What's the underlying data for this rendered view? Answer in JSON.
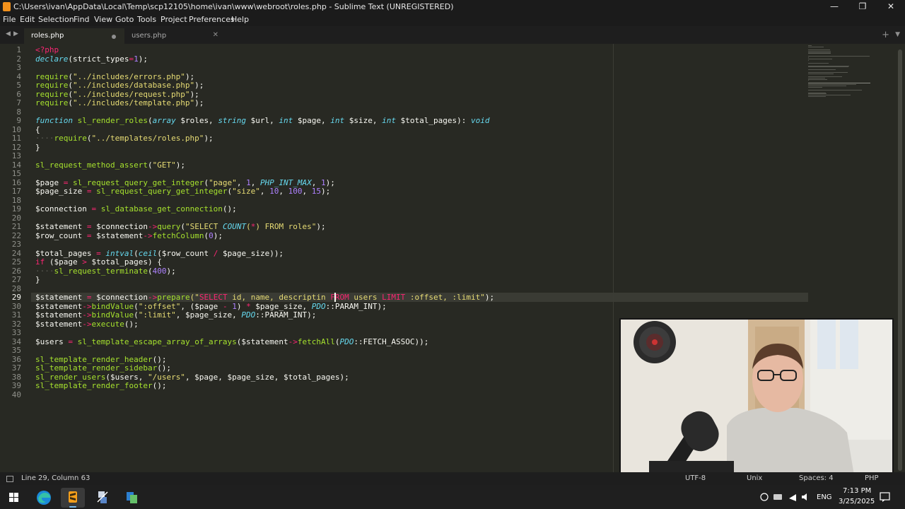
{
  "window": {
    "title": "C:\\Users\\ivan\\AppData\\Local\\Temp\\scp12105\\home\\ivan\\www\\webroot\\roles.php - Sublime Text (UNREGISTERED)",
    "minimize": "—",
    "maximize": "❐",
    "close": "✕"
  },
  "menu": {
    "file": "File",
    "edit": "Edit",
    "selection": "Selection",
    "find": "Find",
    "view": "View",
    "goto": "Goto",
    "tools": "Tools",
    "project": "Project",
    "preferences": "Preferences",
    "help": "Help"
  },
  "tabs": [
    {
      "label": "roles.php",
      "active": true,
      "dirty": true
    },
    {
      "label": "users.php",
      "active": false,
      "dirty": false
    }
  ],
  "tabbar": {
    "back": "◀",
    "forward": "▶",
    "new_tab": "+",
    "tab_menu": "▼",
    "close": "✕"
  },
  "editor": {
    "current_line": 29,
    "line_numbers": [
      "1",
      "2",
      "3",
      "4",
      "5",
      "6",
      "7",
      "8",
      "9",
      "10",
      "11",
      "12",
      "13",
      "14",
      "15",
      "16",
      "17",
      "18",
      "19",
      "20",
      "21",
      "22",
      "23",
      "24",
      "25",
      "26",
      "27",
      "28",
      "29",
      "30",
      "31",
      "32",
      "33",
      "34",
      "35",
      "36",
      "37",
      "38",
      "39",
      "40"
    ],
    "lines": [
      [
        [
          "<?php",
          "c-tag"
        ]
      ],
      [
        [
          "declare",
          "c-it"
        ],
        [
          "(",
          "c-var"
        ],
        [
          "strict_types",
          "c-var"
        ],
        [
          "=",
          "c-op"
        ],
        [
          "1",
          "c-num"
        ],
        [
          ");",
          "c-var"
        ]
      ],
      [],
      [
        [
          "require",
          "c-fn"
        ],
        [
          "(",
          "c-var"
        ],
        [
          "\"../includes/errors.php\"",
          "c-str"
        ],
        [
          ");",
          "c-var"
        ]
      ],
      [
        [
          "require",
          "c-fn"
        ],
        [
          "(",
          "c-var"
        ],
        [
          "\"../includes/database.php\"",
          "c-str"
        ],
        [
          ");",
          "c-var"
        ]
      ],
      [
        [
          "require",
          "c-fn"
        ],
        [
          "(",
          "c-var"
        ],
        [
          "\"../includes/request.php\"",
          "c-str"
        ],
        [
          ");",
          "c-var"
        ]
      ],
      [
        [
          "require",
          "c-fn"
        ],
        [
          "(",
          "c-var"
        ],
        [
          "\"../includes/template.php\"",
          "c-str"
        ],
        [
          ");",
          "c-var"
        ]
      ],
      [],
      [
        [
          "function",
          "c-type"
        ],
        [
          " ",
          "c-var"
        ],
        [
          "sl_render_roles",
          "c-fn"
        ],
        [
          "(",
          "c-var"
        ],
        [
          "array",
          "c-type"
        ],
        [
          " $roles, ",
          "c-var"
        ],
        [
          "string",
          "c-type"
        ],
        [
          " $url, ",
          "c-var"
        ],
        [
          "int",
          "c-type"
        ],
        [
          " $page, ",
          "c-var"
        ],
        [
          "int",
          "c-type"
        ],
        [
          " $size, ",
          "c-var"
        ],
        [
          "int",
          "c-type"
        ],
        [
          " $total_pages): ",
          "c-var"
        ],
        [
          "void",
          "c-type"
        ]
      ],
      [
        [
          "{",
          "c-var"
        ]
      ],
      [
        [
          "····",
          "c-ws"
        ],
        [
          "require",
          "c-fn"
        ],
        [
          "(",
          "c-var"
        ],
        [
          "\"../templates/roles.php\"",
          "c-str"
        ],
        [
          ");",
          "c-var"
        ]
      ],
      [
        [
          "}",
          "c-var"
        ]
      ],
      [],
      [
        [
          "sl_request_method_assert",
          "c-fn"
        ],
        [
          "(",
          "c-var"
        ],
        [
          "\"GET\"",
          "c-str"
        ],
        [
          ");",
          "c-var"
        ]
      ],
      [],
      [
        [
          "$page",
          "c-var"
        ],
        [
          " = ",
          "c-op"
        ],
        [
          "sl_request_query_get_integer",
          "c-fn"
        ],
        [
          "(",
          "c-var"
        ],
        [
          "\"page\"",
          "c-str"
        ],
        [
          ", ",
          "c-var"
        ],
        [
          "1",
          "c-num"
        ],
        [
          ", ",
          "c-var"
        ],
        [
          "PHP_INT_MAX",
          "c-it"
        ],
        [
          ", ",
          "c-var"
        ],
        [
          "1",
          "c-num"
        ],
        [
          ");",
          "c-var"
        ]
      ],
      [
        [
          "$page_size",
          "c-var"
        ],
        [
          " = ",
          "c-op"
        ],
        [
          "sl_request_query_get_integer",
          "c-fn"
        ],
        [
          "(",
          "c-var"
        ],
        [
          "\"size\"",
          "c-str"
        ],
        [
          ", ",
          "c-var"
        ],
        [
          "10",
          "c-num"
        ],
        [
          ", ",
          "c-var"
        ],
        [
          "100",
          "c-num"
        ],
        [
          ", ",
          "c-var"
        ],
        [
          "15",
          "c-num"
        ],
        [
          ");",
          "c-var"
        ]
      ],
      [],
      [
        [
          "$connection",
          "c-var"
        ],
        [
          " = ",
          "c-op"
        ],
        [
          "sl_database_get_connection",
          "c-fn"
        ],
        [
          "();",
          "c-var"
        ]
      ],
      [],
      [
        [
          "$statement",
          "c-var"
        ],
        [
          " = ",
          "c-op"
        ],
        [
          "$connection",
          "c-var"
        ],
        [
          "->",
          "c-op"
        ],
        [
          "query",
          "c-fn"
        ],
        [
          "(",
          "c-var"
        ],
        [
          "\"SELECT ",
          "c-str"
        ],
        [
          "COUNT",
          "c-it"
        ],
        [
          "(",
          "c-str"
        ],
        [
          "*",
          "c-op"
        ],
        [
          ") FROM roles\"",
          "c-str"
        ],
        [
          ");",
          "c-var"
        ]
      ],
      [
        [
          "$row_count",
          "c-var"
        ],
        [
          " = ",
          "c-op"
        ],
        [
          "$statement",
          "c-var"
        ],
        [
          "->",
          "c-op"
        ],
        [
          "fetchColumn",
          "c-fn"
        ],
        [
          "(",
          "c-var"
        ],
        [
          "0",
          "c-num"
        ],
        [
          ");",
          "c-var"
        ]
      ],
      [],
      [
        [
          "$total_pages",
          "c-var"
        ],
        [
          " = ",
          "c-op"
        ],
        [
          "intval",
          "c-it"
        ],
        [
          "(",
          "c-var"
        ],
        [
          "ceil",
          "c-it"
        ],
        [
          "($row_count ",
          "c-var"
        ],
        [
          "/",
          "c-op"
        ],
        [
          " $page_size));",
          "c-var"
        ]
      ],
      [
        [
          "if",
          "c-kw"
        ],
        [
          " ($page ",
          "c-var"
        ],
        [
          ">",
          "c-op"
        ],
        [
          " $total_pages) {",
          "c-var"
        ]
      ],
      [
        [
          "····",
          "c-ws"
        ],
        [
          "sl_request_terminate",
          "c-fn"
        ],
        [
          "(",
          "c-var"
        ],
        [
          "400",
          "c-num"
        ],
        [
          ");",
          "c-var"
        ]
      ],
      [
        [
          "}",
          "c-var"
        ]
      ],
      [],
      [
        [
          "$statement",
          "c-var"
        ],
        [
          " = ",
          "c-op"
        ],
        [
          "$connection",
          "c-var"
        ],
        [
          "->",
          "c-op"
        ],
        [
          "prepare",
          "c-fn"
        ],
        [
          "(\"",
          "c-str"
        ],
        [
          "SELECT",
          "c-sql"
        ],
        [
          " id, name, descriptin ",
          "c-str"
        ],
        [
          "FROM",
          "c-sql"
        ],
        [
          " users ",
          "c-str"
        ],
        [
          "LIMIT",
          "c-sql"
        ],
        [
          " :offset, :limit\"",
          "c-str"
        ],
        [
          ");",
          "c-var"
        ]
      ],
      [
        [
          "$statement",
          "c-var"
        ],
        [
          "->",
          "c-op"
        ],
        [
          "bindValue",
          "c-fn"
        ],
        [
          "(",
          "c-var"
        ],
        [
          "\":offset\"",
          "c-str"
        ],
        [
          ", ($page ",
          "c-var"
        ],
        [
          "-",
          "c-op"
        ],
        [
          " ",
          "c-var"
        ],
        [
          "1",
          "c-num"
        ],
        [
          ") ",
          "c-var"
        ],
        [
          "*",
          "c-op"
        ],
        [
          " $page_size, ",
          "c-var"
        ],
        [
          "PDO",
          "c-it"
        ],
        [
          "::PARAM_INT);",
          "c-var"
        ]
      ],
      [
        [
          "$statement",
          "c-var"
        ],
        [
          "->",
          "c-op"
        ],
        [
          "bindValue",
          "c-fn"
        ],
        [
          "(",
          "c-var"
        ],
        [
          "\":limit\"",
          "c-str"
        ],
        [
          ", $page_size, ",
          "c-var"
        ],
        [
          "PDO",
          "c-it"
        ],
        [
          "::PARAM_INT);",
          "c-var"
        ]
      ],
      [
        [
          "$statement",
          "c-var"
        ],
        [
          "->",
          "c-op"
        ],
        [
          "execute",
          "c-fn"
        ],
        [
          "();",
          "c-var"
        ]
      ],
      [],
      [
        [
          "$users",
          "c-var"
        ],
        [
          " = ",
          "c-op"
        ],
        [
          "sl_template_escape_array_of_arrays",
          "c-fn"
        ],
        [
          "($statement",
          "c-var"
        ],
        [
          "->",
          "c-op"
        ],
        [
          "fetchAll",
          "c-fn"
        ],
        [
          "(",
          "c-var"
        ],
        [
          "PDO",
          "c-it"
        ],
        [
          "::FETCH_ASSOC));",
          "c-var"
        ]
      ],
      [],
      [
        [
          "sl_template_render_header",
          "c-fn"
        ],
        [
          "();",
          "c-var"
        ]
      ],
      [
        [
          "sl_template_render_sidebar",
          "c-fn"
        ],
        [
          "();",
          "c-var"
        ]
      ],
      [
        [
          "sl_render_users",
          "c-fn"
        ],
        [
          "($users, ",
          "c-var"
        ],
        [
          "\"/users\"",
          "c-str"
        ],
        [
          ", $page, $page_size, $total_pages);",
          "c-var"
        ]
      ],
      [
        [
          "sl_template_render_footer",
          "c-fn"
        ],
        [
          "();",
          "c-var"
        ]
      ],
      []
    ]
  },
  "status": {
    "position": "Line 29, Column 63",
    "encoding": "UTF-8",
    "line_endings": "Unix",
    "indentation": "Spaces: 4",
    "syntax": "PHP"
  },
  "taskbar": {
    "language": "ENG",
    "time": "7:13 PM",
    "date": "3/25/2025",
    "apps": [
      "windows-start-icon",
      "edge-icon",
      "sublime-text-icon",
      "network-app-icon",
      "file-transfer-icon"
    ]
  },
  "colors": {
    "editor_bg": "#282923",
    "keyword": "#f92672",
    "function": "#a6e22e",
    "string": "#e6db74",
    "number": "#ae81ff",
    "type": "#66d9ef"
  }
}
